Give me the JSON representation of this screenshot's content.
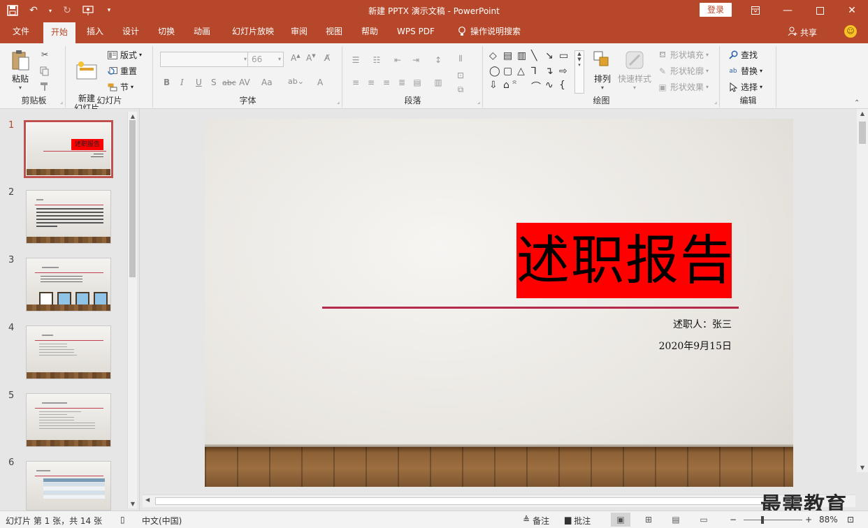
{
  "titlebar": {
    "title": "新建 PPTX 演示文稿  -  PowerPoint",
    "login": "登录"
  },
  "tabs": [
    {
      "label": "文件"
    },
    {
      "label": "开始"
    },
    {
      "label": "插入"
    },
    {
      "label": "设计"
    },
    {
      "label": "切换"
    },
    {
      "label": "动画"
    },
    {
      "label": "幻灯片放映"
    },
    {
      "label": "审阅"
    },
    {
      "label": "视图"
    },
    {
      "label": "帮助"
    },
    {
      "label": "WPS PDF"
    },
    {
      "label": "操作说明搜索"
    }
  ],
  "share": "共享",
  "ribbon": {
    "clipboard": {
      "label": "剪贴板",
      "paste": "粘贴"
    },
    "slides": {
      "label": "幻灯片",
      "new_slide": "新建\n幻灯片",
      "layout": "版式",
      "reset": "重置",
      "section": "节"
    },
    "font": {
      "label": "字体",
      "font_name": "",
      "font_size": "66",
      "buttons": [
        "B",
        "I",
        "U",
        "S",
        "abc",
        "AV",
        "Aa",
        "A",
        "A"
      ]
    },
    "paragraph": {
      "label": "段落"
    },
    "drawing": {
      "label": "绘图",
      "arrange": "排列",
      "quick_styles": "快速样式",
      "shape_fill": "形状填充",
      "shape_outline": "形状轮廓",
      "shape_effects": "形状效果"
    },
    "editing": {
      "label": "编辑",
      "find": "查找",
      "replace": "替换",
      "select": "选择"
    }
  },
  "thumbnails": [
    {
      "number": "1",
      "active": true
    },
    {
      "number": "2",
      "active": false
    },
    {
      "number": "3",
      "active": false
    },
    {
      "number": "4",
      "active": false
    },
    {
      "number": "5",
      "active": false
    },
    {
      "number": "6",
      "active": false
    }
  ],
  "slide": {
    "title": "述职报告",
    "reporter": "述职人：张三",
    "date": "2020年9月15日"
  },
  "watermark": "最需教育",
  "status": {
    "slide_info": "幻灯片 第 1 张，共 14 张",
    "language": "中文(中国)",
    "notes": "备注",
    "comments": "批注",
    "zoom": "88%"
  },
  "colors": {
    "brand": "#b7472a",
    "title_fill": "#ff0000",
    "rule": "#b5294a"
  }
}
